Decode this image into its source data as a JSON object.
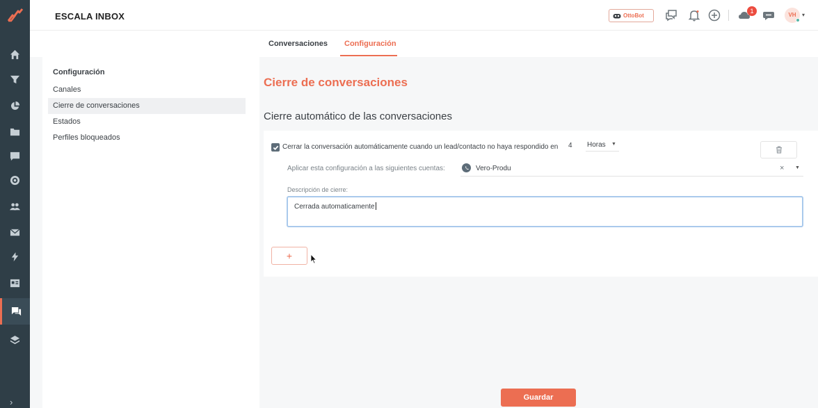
{
  "app": {
    "title": "ESCALA INBOX"
  },
  "nav": {
    "icons": [
      "home-icon",
      "filter-icon",
      "pie-chart-icon",
      "folder-icon",
      "message-square-icon",
      "target-icon",
      "users-icon",
      "mail-icon",
      "lightning-icon",
      "news-icon",
      "chat-bubbles-icon",
      "layers-icon"
    ],
    "active": "chat-bubbles-icon",
    "expand_glyph": "›"
  },
  "topbar": {
    "ottobot_label": "OttoBot",
    "notifications_count": "1",
    "avatar_initials": "VH"
  },
  "tabs": [
    {
      "label": "Conversaciones",
      "active": false
    },
    {
      "label": "Configuración",
      "active": true
    }
  ],
  "settings_sidebar": {
    "heading": "Configuración",
    "items": [
      {
        "label": "Canales",
        "active": false
      },
      {
        "label": "Cierre de conversaciones",
        "active": true
      },
      {
        "label": "Estados",
        "active": false
      },
      {
        "label": "Perfiles bloqueados",
        "active": false
      }
    ]
  },
  "main": {
    "section_title": "Cierre de conversaciones",
    "subsection_title": "Cierre automático de las conversaciones",
    "rule": {
      "checked": true,
      "text": "Cerrar la conversación automáticamente cuando un lead/contacto no haya respondido en",
      "value": "4",
      "unit": "Horas",
      "accounts_label": "Aplicar esta configuración a las siguientes cuentas:",
      "account": "Vero-Produ",
      "clear_glyph": "×",
      "description_label": "Descripción de cierre:",
      "description": "Cerrada automaticamente"
    },
    "add_label": "+",
    "save_label": "Guardar"
  },
  "colors": {
    "accent": "#ec6e52",
    "nav_bg": "#2f3e47",
    "badge": "#ec4c3f",
    "online": "#53b6a5"
  }
}
